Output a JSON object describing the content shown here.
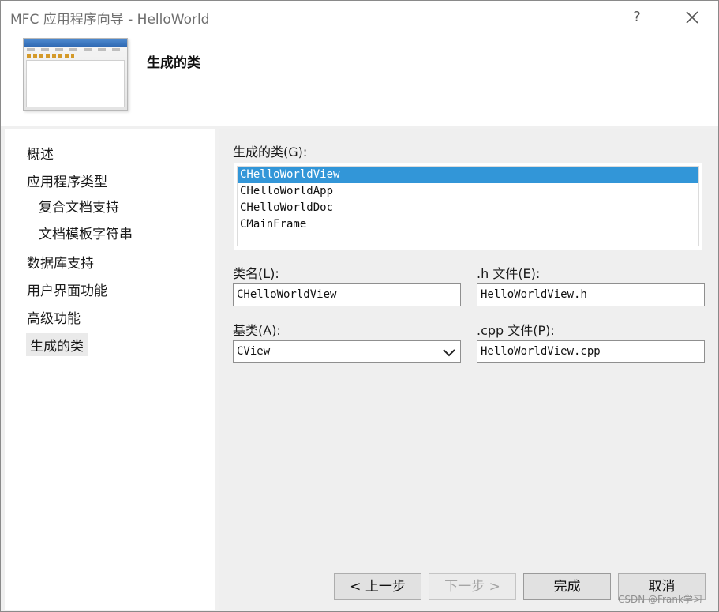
{
  "window": {
    "title": "MFC 应用程序向导 - HelloWorld",
    "help_glyph": "?"
  },
  "header": {
    "page_title": "生成的类"
  },
  "sidebar": {
    "items": [
      {
        "label": "概述"
      },
      {
        "label": "应用程序类型"
      },
      {
        "label": "复合文档支持"
      },
      {
        "label": "文档模板字符串"
      },
      {
        "label": "数据库支持"
      },
      {
        "label": "用户界面功能"
      },
      {
        "label": "高级功能"
      },
      {
        "label": "生成的类"
      }
    ]
  },
  "main": {
    "classes_label": "生成的类(G):",
    "classes": [
      "CHelloWorldView",
      "CHelloWorldApp",
      "CHelloWorldDoc",
      "CMainFrame"
    ],
    "class_name_label": "类名(L):",
    "class_name_value": "CHelloWorldView",
    "h_file_label": ".h 文件(E):",
    "h_file_value": "HelloWorldView.h",
    "base_class_label": "基类(A):",
    "base_class_value": "CView",
    "cpp_file_label": ".cpp 文件(P):",
    "cpp_file_value": "HelloWorldView.cpp"
  },
  "buttons": {
    "prev": "< 上一步",
    "next": "下一步 >",
    "finish": "完成",
    "cancel": "取消"
  },
  "watermark": "CSDN @Frank学习",
  "colors": {
    "selection": "#3296d8",
    "window_bg": "#f0f0f0"
  }
}
